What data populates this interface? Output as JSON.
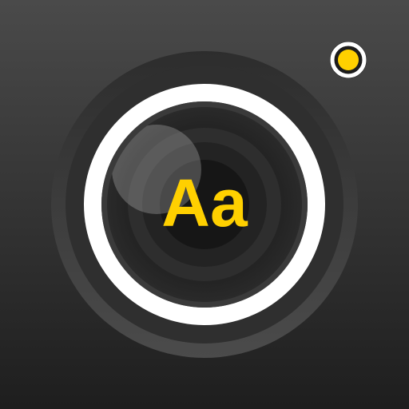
{
  "app_icon": {
    "lens_text": "Aa",
    "colors": {
      "background_top": "#4a4a4a",
      "background_bottom": "#1e1e1e",
      "outer_ring": "#3f3f3f",
      "white_ring": "#ffffff",
      "lens_outer": "#2c2c2c",
      "lens_mid": "#242424",
      "lens_inner": "#111111",
      "accent_yellow": "#ffd000",
      "indicator_ring": "#ffffff"
    },
    "icons": [
      "camera-lens-icon",
      "recording-indicator-icon"
    ]
  }
}
